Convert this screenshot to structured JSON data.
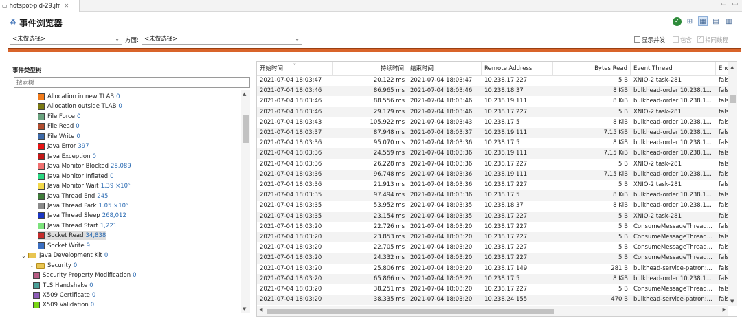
{
  "tab": {
    "title": "hotspot-pid-29.jfr",
    "close": "✕"
  },
  "window": {
    "minimize": "▭",
    "maximize": "▭"
  },
  "header": {
    "title": "事件浏览器"
  },
  "filters": {
    "type_select": "<未做选择>",
    "aspect_label": "方面:",
    "aspect_select": "<未做选择>",
    "show_concurrent": "显示并发:",
    "contains": "包含",
    "same_thread": "相同线程"
  },
  "tree": {
    "title": "事件类型树",
    "search_placeholder": "搜索树",
    "items": [
      {
        "label": "Allocation in new TLAB",
        "count": "0",
        "color": "#f07a1a",
        "level": 2
      },
      {
        "label": "Allocation outside TLAB",
        "count": "0",
        "color": "#7a7a12",
        "level": 2
      },
      {
        "label": "File Force",
        "count": "0",
        "color": "#6aa27e",
        "level": 2
      },
      {
        "label": "File Read",
        "count": "0",
        "color": "#b14d2f",
        "level": 2
      },
      {
        "label": "File Write",
        "count": "0",
        "color": "#3c6aa8",
        "level": 2
      },
      {
        "label": "Java Error",
        "count": "397",
        "color": "#e81313",
        "level": 2
      },
      {
        "label": "Java Exception",
        "count": "0",
        "color": "#c41818",
        "level": 2
      },
      {
        "label": "Java Monitor Blocked",
        "count": "28,089",
        "color": "#f07070",
        "level": 2
      },
      {
        "label": "Java Monitor Inflated",
        "count": "0",
        "color": "#2ad882",
        "level": 2
      },
      {
        "label": "Java Monitor Wait",
        "count": "1.39 ×10⁶",
        "color": "#f2d84a",
        "level": 2
      },
      {
        "label": "Java Thread End",
        "count": "245",
        "color": "#3f7d3a",
        "level": 2
      },
      {
        "label": "Java Thread Park",
        "count": "1.05 ×10⁶",
        "color": "#8a8a8a",
        "level": 2
      },
      {
        "label": "Java Thread Sleep",
        "count": "268,012",
        "color": "#1a36c4",
        "level": 2
      },
      {
        "label": "Java Thread Start",
        "count": "1,221",
        "color": "#7ce27c",
        "level": 2
      },
      {
        "label": "Socket Read",
        "count": "34,838",
        "color": "#c42c2c",
        "level": 2,
        "selected": true
      },
      {
        "label": "Socket Write",
        "count": "9",
        "color": "#3b6fc1",
        "level": 2
      },
      {
        "label": "Java Development Kit",
        "count": "0",
        "folder": true,
        "level": 0
      },
      {
        "label": "Security",
        "count": "0",
        "folder": true,
        "level": 1
      },
      {
        "label": "Security Property Modification",
        "count": "0",
        "color": "#b85c84",
        "level": 3
      },
      {
        "label": "TLS Handshake",
        "count": "0",
        "color": "#4aa098",
        "level": 3
      },
      {
        "label": "X509 Certificate",
        "count": "0",
        "color": "#8e5cb8",
        "level": 3
      },
      {
        "label": "X509 Validation",
        "count": "0",
        "color": "#7ad616",
        "level": 3
      }
    ]
  },
  "table": {
    "columns": [
      "开始时间",
      "持续时间",
      "结束时间",
      "Remote Address",
      "Bytes Read",
      "Event Thread",
      "End"
    ],
    "rows": [
      [
        "2021-07-04 18:03:47",
        "20.122 ms",
        "2021-07-04 18:03:47",
        "10.238.17.227",
        "5 B",
        "XNIO-2 task-281",
        "fals"
      ],
      [
        "2021-07-04 18:03:46",
        "86.965 ms",
        "2021-07-04 18:03:46",
        "10.238.18.37",
        "8 KiB",
        "bulkhead-order:10.238.1...",
        "fals"
      ],
      [
        "2021-07-04 18:03:46",
        "88.556 ms",
        "2021-07-04 18:03:46",
        "10.238.19.111",
        "8 KiB",
        "bulkhead-order:10.238.1...",
        "fals"
      ],
      [
        "2021-07-04 18:03:46",
        "29.179 ms",
        "2021-07-04 18:03:46",
        "10.238.17.227",
        "5 B",
        "XNIO-2 task-281",
        "fals"
      ],
      [
        "2021-07-04 18:03:43",
        "105.922 ms",
        "2021-07-04 18:03:43",
        "10.238.17.5",
        "8 KiB",
        "bulkhead-order:10.238.1...",
        "fals"
      ],
      [
        "2021-07-04 18:03:37",
        "87.948 ms",
        "2021-07-04 18:03:37",
        "10.238.19.111",
        "7.15 KiB",
        "bulkhead-order:10.238.1...",
        "fals"
      ],
      [
        "2021-07-04 18:03:36",
        "95.070 ms",
        "2021-07-04 18:03:36",
        "10.238.17.5",
        "8 KiB",
        "bulkhead-order:10.238.1...",
        "fals"
      ],
      [
        "2021-07-04 18:03:36",
        "24.559 ms",
        "2021-07-04 18:03:36",
        "10.238.19.111",
        "7.15 KiB",
        "bulkhead-order:10.238.1...",
        "fals"
      ],
      [
        "2021-07-04 18:03:36",
        "26.228 ms",
        "2021-07-04 18:03:36",
        "10.238.17.227",
        "5 B",
        "XNIO-2 task-281",
        "fals"
      ],
      [
        "2021-07-04 18:03:36",
        "96.748 ms",
        "2021-07-04 18:03:36",
        "10.238.19.111",
        "7.15 KiB",
        "bulkhead-order:10.238.1...",
        "fals"
      ],
      [
        "2021-07-04 18:03:36",
        "21.913 ms",
        "2021-07-04 18:03:36",
        "10.238.17.227",
        "5 B",
        "XNIO-2 task-281",
        "fals"
      ],
      [
        "2021-07-04 18:03:35",
        "97.494 ms",
        "2021-07-04 18:03:36",
        "10.238.17.5",
        "8 KiB",
        "bulkhead-order:10.238.1...",
        "fals"
      ],
      [
        "2021-07-04 18:03:35",
        "53.952 ms",
        "2021-07-04 18:03:35",
        "10.238.18.37",
        "8 KiB",
        "bulkhead-order:10.238.1...",
        "fals"
      ],
      [
        "2021-07-04 18:03:35",
        "23.154 ms",
        "2021-07-04 18:03:35",
        "10.238.17.227",
        "5 B",
        "XNIO-2 task-281",
        "fals"
      ],
      [
        "2021-07-04 18:03:20",
        "22.726 ms",
        "2021-07-04 18:03:20",
        "10.238.17.227",
        "5 B",
        "ConsumeMessageThread...",
        "fals"
      ],
      [
        "2021-07-04 18:03:20",
        "23.853 ms",
        "2021-07-04 18:03:20",
        "10.238.17.227",
        "5 B",
        "ConsumeMessageThread...",
        "fals"
      ],
      [
        "2021-07-04 18:03:20",
        "22.705 ms",
        "2021-07-04 18:03:20",
        "10.238.17.227",
        "5 B",
        "ConsumeMessageThread...",
        "fals"
      ],
      [
        "2021-07-04 18:03:20",
        "24.332 ms",
        "2021-07-04 18:03:20",
        "10.238.17.227",
        "5 B",
        "ConsumeMessageThread...",
        "fals"
      ],
      [
        "2021-07-04 18:03:20",
        "25.806 ms",
        "2021-07-04 18:03:20",
        "10.238.17.149",
        "281 B",
        "bulkhead-service-patron:...",
        "fals"
      ],
      [
        "2021-07-04 18:03:20",
        "65.866 ms",
        "2021-07-04 18:03:20",
        "10.238.17.5",
        "8 KiB",
        "bulkhead-order:10.238.1...",
        "fals"
      ],
      [
        "2021-07-04 18:03:20",
        "38.251 ms",
        "2021-07-04 18:03:20",
        "10.238.17.227",
        "5 B",
        "ConsumeMessageThread...",
        "fals"
      ],
      [
        "2021-07-04 18:03:20",
        "38.335 ms",
        "2021-07-04 18:03:20",
        "10.238.24.155",
        "470 B",
        "bulkhead-service-patron:...",
        "fals"
      ]
    ]
  }
}
